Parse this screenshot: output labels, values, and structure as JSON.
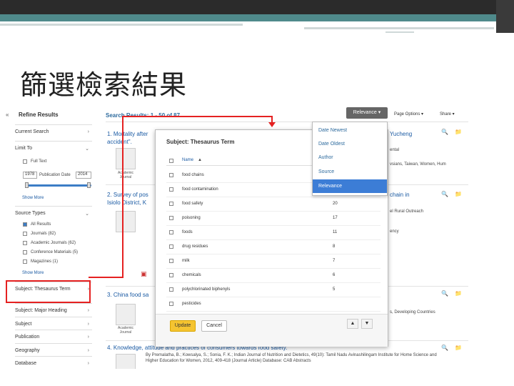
{
  "slide": {
    "title": "篩選檢索結果"
  },
  "sidebar": {
    "collapse": "«",
    "refine": "Refine Results",
    "current_search": "Current Search",
    "limit_to": "Limit To",
    "full_text": "Full Text",
    "pub_date_from": "1978",
    "pub_date_label": "Publication Date",
    "pub_date_to": "2014",
    "show_more": "Show More",
    "source_types": "Source Types",
    "all_results": "All Results",
    "journals": "Journals (82)",
    "academic_journals": "Academic Journals (62)",
    "conference": "Conference Materials (5)",
    "magazines": "Magazines (1)",
    "show_more_2": "Show More",
    "subject_thesaurus": "Subject: Thesaurus Term",
    "subject_major": "Subject: Major Heading",
    "subject": "Subject",
    "publication": "Publication",
    "geography": "Geography",
    "database": "Database"
  },
  "results": {
    "heading": "Search Results: 1 - 50 of 87",
    "relevance_btn": "Relevance ▾",
    "page_options": "Page Options ▾",
    "share": "Share ▾",
    "r1_title": "1. Mortality after",
    "r1_title2": "accident\".",
    "r1_right": "Yucheng",
    "r1_sub_right": "ental",
    "r1_sub_right2": "vsians, Taiwan, Women, Hum",
    "r2_title": "2. Survey of pos",
    "r2_title2": "Isiolo District, K",
    "r2_right": "chain in",
    "r2_sub_right": "el Rural Outreach",
    "r2_sub_right2": "ency",
    "r3_title": "3. China food sa",
    "r3_sub_right": "s, Developing Countries",
    "r4_title": "4. Knowledge, attitude and practices of consumers towards food safety.",
    "r4_sub": "By Premalatha, B.; Kowsalya, S.; Sonia, F. K.; Indian Journal of Nutrition and Dietetics, 49(10): Tamil Nadu Avinashilingam Institute for Home Science and",
    "r4_sub2": "Higher Education for Women, 2012, 409-418 (Journal Article) Database: CAB Abstracts",
    "type_label": "Academic Journal"
  },
  "modal": {
    "title": "Subject: Thesaurus Term",
    "col_name": "Name",
    "rows": [
      {
        "name": "food chains",
        "count": ""
      },
      {
        "name": "food contamination",
        "count": ""
      },
      {
        "name": "food safety",
        "count": "20"
      },
      {
        "name": "poisoning",
        "count": "17"
      },
      {
        "name": "foods",
        "count": "11"
      },
      {
        "name": "drug residues",
        "count": "8"
      },
      {
        "name": "milk",
        "count": "7"
      },
      {
        "name": "chemicals",
        "count": "6"
      },
      {
        "name": "polychlorinated biphenyls",
        "count": "5"
      },
      {
        "name": "pesticides",
        "count": ""
      }
    ],
    "update": "Update",
    "cancel": "Cancel",
    "prev": "▲",
    "next": "▼"
  },
  "sort_menu": {
    "items": [
      "Date Newest",
      "Date Oldest",
      "Author",
      "Source",
      "Relevance"
    ],
    "selected": "Relevance"
  },
  "colors": {
    "accent_red": "#e52121",
    "link_blue": "#1a5aa3",
    "selected_blue": "#3c7dd6",
    "update_yellow": "#f5c431"
  }
}
